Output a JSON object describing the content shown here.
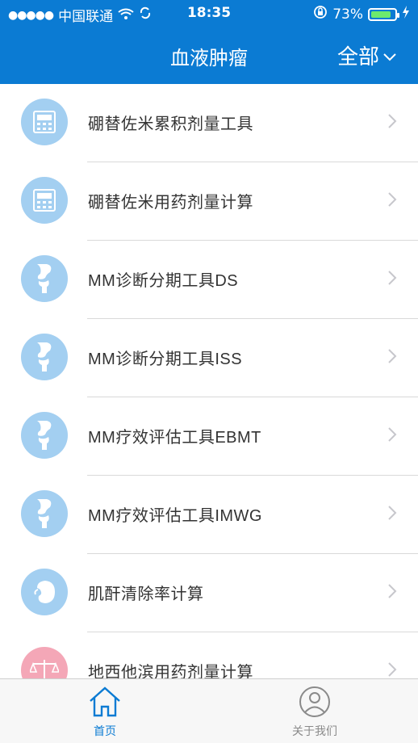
{
  "status_bar": {
    "signal": "●●●●●",
    "carrier": "中国联通",
    "time": "18:35",
    "battery": "73%"
  },
  "nav": {
    "title": "血液肿瘤",
    "filter_label": "全部"
  },
  "list": [
    {
      "label": "硼替佐米累积剂量工具",
      "icon": "calculator-icon"
    },
    {
      "label": "硼替佐米用药剂量计算",
      "icon": "calculator-icon"
    },
    {
      "label": "MM诊断分期工具DS",
      "icon": "bone-joint-icon"
    },
    {
      "label": "MM诊断分期工具ISS",
      "icon": "bone-joint-icon"
    },
    {
      "label": "MM疗效评估工具EBMT",
      "icon": "bone-joint-icon"
    },
    {
      "label": "MM疗效评估工具IMWG",
      "icon": "bone-joint-icon"
    },
    {
      "label": "肌酐清除率计算",
      "icon": "kidney-icon"
    },
    {
      "label": "地西他滨用药剂量计算",
      "icon": "balance-scale-icon"
    }
  ],
  "tabs": {
    "home_label": "首页",
    "about_label": "关于我们"
  },
  "colors": {
    "primary": "#0b7bd3",
    "icon_blue": "#a3cff1",
    "icon_pink": "#f4a7b7"
  }
}
